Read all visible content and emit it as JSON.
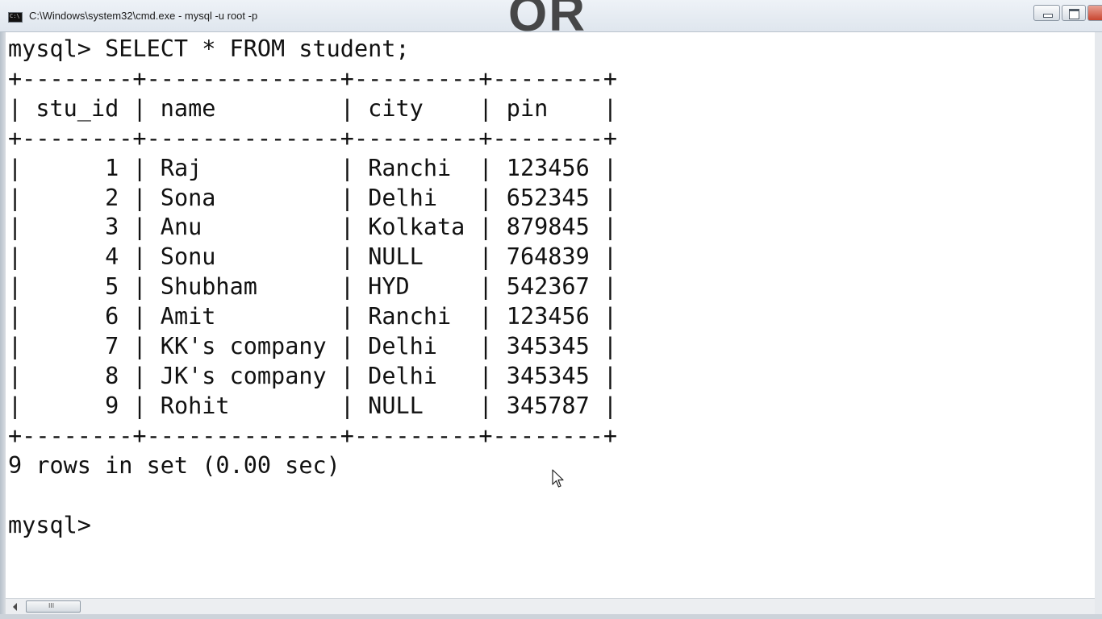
{
  "window": {
    "title": "C:\\Windows\\system32\\cmd.exe - mysql  -u root -p",
    "background_logo": "OR"
  },
  "icons": {
    "app": "cmd-icon",
    "minimize": "minimize-icon",
    "maximize": "maximize-icon",
    "close": "close-icon",
    "cursor": "mouse-pointer-icon"
  },
  "console": {
    "query_line": "mysql> SELECT * FROM student;",
    "table": {
      "columns": [
        "stu_id",
        "name",
        "city",
        "pin"
      ],
      "rows": [
        [
          "1",
          "Raj",
          "Ranchi",
          "123456"
        ],
        [
          "2",
          "Sona",
          "Delhi",
          "652345"
        ],
        [
          "3",
          "Anu",
          "Kolkata",
          "879845"
        ],
        [
          "4",
          "Sonu",
          "NULL",
          "764839"
        ],
        [
          "5",
          "Shubham",
          "HYD",
          "542367"
        ],
        [
          "6",
          "Amit",
          "Ranchi",
          "123456"
        ],
        [
          "7",
          "KK's company",
          "Delhi",
          "345345"
        ],
        [
          "8",
          "JK's company",
          "Delhi",
          "345345"
        ],
        [
          "9",
          "Rohit",
          "NULL",
          "345787"
        ]
      ]
    },
    "result_line": "9 rows in set (0.00 sec)",
    "prompt_line": "mysql>"
  },
  "scrollbar": {
    "thumb_grip": "III"
  },
  "colors": {
    "console_bg": "#ffffff",
    "console_text": "#111111",
    "titlebar": "#e6ebf1",
    "close_button": "#c8452f"
  }
}
